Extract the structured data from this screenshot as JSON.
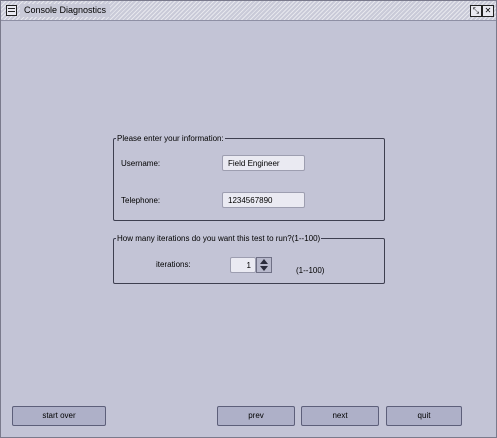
{
  "window": {
    "title": "Console Diagnostics"
  },
  "info_group": {
    "legend": "Please enter your information:",
    "username_label": "Username:",
    "username_value": "Field Engineer",
    "telephone_label": "Telephone:",
    "telephone_value": "1234567890"
  },
  "iterations_group": {
    "legend": "How many iterations do you want this test to run?(1--100)",
    "iterations_label": "iterations:",
    "iterations_value": "1",
    "range_hint": "(1--100)"
  },
  "buttons": {
    "start_over": "start over",
    "prev": "prev",
    "next": "next",
    "quit": "quit"
  },
  "icons": {
    "window_menu": "window-menu-icon",
    "restore": "restore-icon",
    "close": "close-icon",
    "spin_up": "triangle-up-icon",
    "spin_down": "triangle-down-icon"
  }
}
